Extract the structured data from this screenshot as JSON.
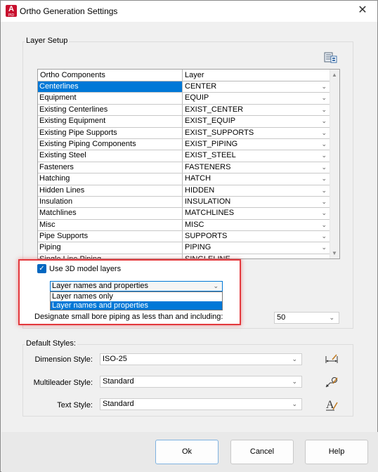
{
  "window": {
    "title": "Ortho Generation Settings",
    "app_icon_letter": "A",
    "app_icon_sub": "PID"
  },
  "layer_setup": {
    "group_label": "Layer Setup",
    "columns": [
      "Ortho Components",
      "Layer"
    ],
    "rows": [
      {
        "component": "Centerlines",
        "layer": "CENTER",
        "selected": true
      },
      {
        "component": "Equipment",
        "layer": "EQUIP"
      },
      {
        "component": "Existing Centerlines",
        "layer": "EXIST_CENTER"
      },
      {
        "component": "Existing Equipment",
        "layer": "EXIST_EQUIP"
      },
      {
        "component": "Existing Pipe Supports",
        "layer": "EXIST_SUPPORTS"
      },
      {
        "component": "Existing Piping Components",
        "layer": "EXIST_PIPING"
      },
      {
        "component": "Existing Steel",
        "layer": "EXIST_STEEL"
      },
      {
        "component": "Fasteners",
        "layer": "FASTENERS"
      },
      {
        "component": "Hatching",
        "layer": "HATCH"
      },
      {
        "component": "Hidden Lines",
        "layer": "HIDDEN"
      },
      {
        "component": "Insulation",
        "layer": "INSULATION"
      },
      {
        "component": "Matchlines",
        "layer": "MATCHLINES"
      },
      {
        "component": "Misc",
        "layer": "MISC"
      },
      {
        "component": "Pipe Supports",
        "layer": "SUPPORTS"
      },
      {
        "component": "Piping",
        "layer": "PIPING"
      },
      {
        "component": "Single Line Piping",
        "layer": "SINGLELINE"
      }
    ],
    "use_3d_layers_label": "Use 3D model layers",
    "use_3d_layers_checked": true,
    "layer_mode_selected": "Layer names and properties",
    "layer_mode_options": [
      "Layer names only",
      "Layer names and properties"
    ],
    "small_bore_label": "Designate small bore piping as less than and including:",
    "small_bore_value": "50"
  },
  "default_styles": {
    "group_label": "Default Styles:",
    "dimension_label": "Dimension Style:",
    "dimension_value": "ISO-25",
    "multileader_label": "Multileader Style:",
    "multileader_value": "Standard",
    "text_label": "Text Style:",
    "text_value": "Standard"
  },
  "buttons": {
    "ok": "Ok",
    "cancel": "Cancel",
    "help": "Help"
  },
  "colors": {
    "selection": "#0078d7",
    "highlight_border": "#e3393d",
    "checkbox": "#0067c0",
    "app_icon": "#c8102e"
  },
  "icons": {
    "layer_manager": "layer-manager-icon",
    "dimension": "dimension-style-icon",
    "multileader": "multileader-style-icon",
    "text": "text-style-icon"
  }
}
